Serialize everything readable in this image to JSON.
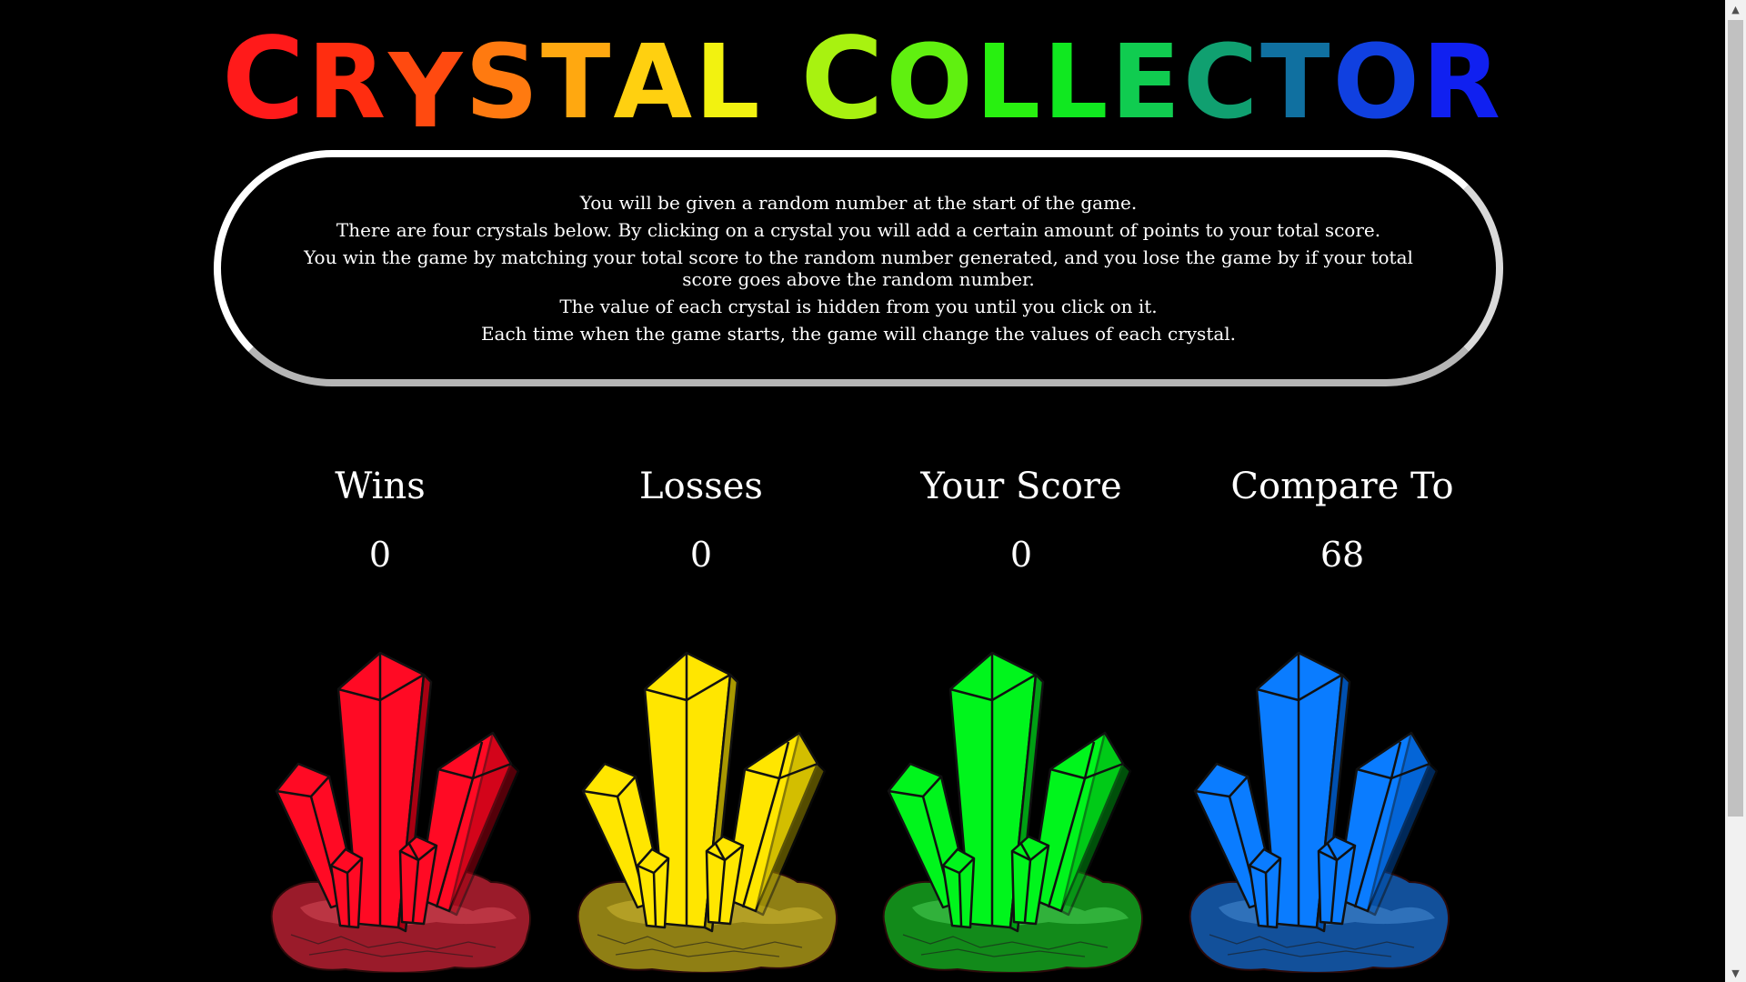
{
  "title": {
    "text": "Crystal Collector",
    "letters": [
      {
        "char": "C",
        "color": "#ff1a1a",
        "big": true
      },
      {
        "char": "R",
        "color": "#ff2d10",
        "big": false
      },
      {
        "char": "Y",
        "color": "#ff4a10",
        "big": false
      },
      {
        "char": "S",
        "color": "#ff7a10",
        "big": false
      },
      {
        "char": "T",
        "color": "#ffa810",
        "big": false
      },
      {
        "char": "A",
        "color": "#ffd010",
        "big": false
      },
      {
        "char": "L",
        "color": "#f2f210",
        "big": false
      },
      {
        "char": " ",
        "color": "#000000",
        "big": false
      },
      {
        "char": "C",
        "color": "#a8f210",
        "big": true
      },
      {
        "char": "O",
        "color": "#60f010",
        "big": false
      },
      {
        "char": "L",
        "color": "#28f010",
        "big": false
      },
      {
        "char": "L",
        "color": "#10e820",
        "big": false
      },
      {
        "char": "E",
        "color": "#10cc50",
        "big": false
      },
      {
        "char": "C",
        "color": "#10a070",
        "big": false
      },
      {
        "char": "T",
        "color": "#1070a0",
        "big": false
      },
      {
        "char": "O",
        "color": "#1040e0",
        "big": false
      },
      {
        "char": "R",
        "color": "#1020f0",
        "big": false
      }
    ]
  },
  "instructions": [
    "You will be given a random number at the start of the game.",
    "There are four crystals below. By clicking on a crystal you will add a certain amount of points to your total score.",
    "You win the game by matching your total score to the random number generated, and you lose the game by if your total score goes above the random number.",
    "The value of each crystal is hidden from you until you click on it.",
    "Each time when the game starts, the game will change the values of each crystal."
  ],
  "stats": {
    "wins": {
      "label": "Wins",
      "value": "0"
    },
    "losses": {
      "label": "Losses",
      "value": "0"
    },
    "score": {
      "label": "Your Score",
      "value": "0"
    },
    "target": {
      "label": "Compare To",
      "value": "68"
    }
  },
  "crystals": [
    {
      "name": "red",
      "fill": "#ff0a24",
      "dark": "#a80012",
      "rock": "#9a1b2a",
      "rockLight": "#c9404f"
    },
    {
      "name": "yellow",
      "fill": "#ffe600",
      "dark": "#a89800",
      "rock": "#8f7f14",
      "rockLight": "#c2ad2c"
    },
    {
      "name": "green",
      "fill": "#00f51c",
      "dark": "#00a014",
      "rock": "#128a1a",
      "rockLight": "#3fc24a"
    },
    {
      "name": "blue",
      "fill": "#0a7cff",
      "dark": "#0050b0",
      "rock": "#12509a",
      "rockLight": "#3c7fc7"
    }
  ],
  "icons": {
    "scroll_up": "scroll-up-arrow-icon",
    "scroll_down": "scroll-down-arrow-icon"
  }
}
